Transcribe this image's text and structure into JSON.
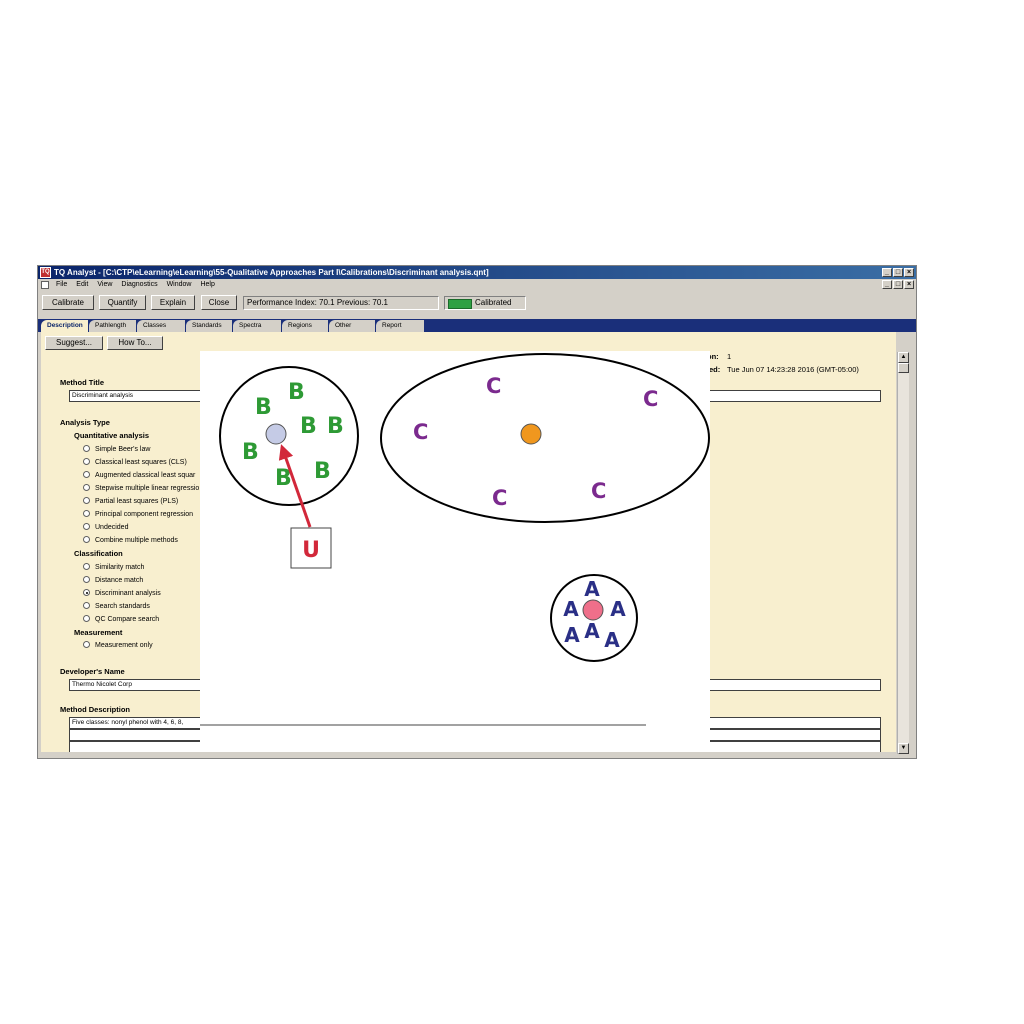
{
  "window": {
    "title": "TQ Analyst  - [C:\\CTP\\eLearning\\eLearning\\55-Qualitative Approaches Part I\\Calibrations\\Discriminant analysis.qnt]",
    "app_icon_label": "TQ"
  },
  "menu": [
    "File",
    "Edit",
    "View",
    "Diagnostics",
    "Window",
    "Help"
  ],
  "toolbar": {
    "buttons": [
      "Calibrate",
      "Quantify",
      "Explain",
      "Close"
    ],
    "performance": "Performance Index:  70.1  Previous:  70.1",
    "status": "Calibrated",
    "status_color": "#2ea043"
  },
  "tabs": [
    "Description",
    "Pathlength",
    "Classes",
    "Standards",
    "Spectra",
    "Regions",
    "Other",
    "Report"
  ],
  "description": {
    "suggest_label": "Suggest...",
    "howto_label": "How To...",
    "version_label": "on:",
    "version_value": "1",
    "date_label": "ed:",
    "date_value": "Tue Jun 07 14:23:28 2016 (GMT-05:00)",
    "method_title_label": "Method Title",
    "method_title_value": "Discriminant analysis",
    "analysis_type_label": "Analysis Type",
    "quantitative_label": "Quantitative analysis",
    "quantitative_options": [
      "Simple Beer's law",
      "Classical least squares (CLS)",
      "Augmented classical least squar",
      "Stepwise multiple linear regressio",
      "Partial least squares (PLS)",
      "Principal component regression",
      "Undecided",
      "Combine multiple methods"
    ],
    "classification_label": "Classification",
    "classification_options": [
      "Similarity match",
      "Distance match",
      "Discriminant analysis",
      "Search standards",
      "QC Compare search"
    ],
    "selected_option": "Discriminant analysis",
    "measurement_label": "Measurement",
    "measurement_options": [
      "Measurement only"
    ],
    "developer_label": "Developer's Name",
    "developer_value": "Thermo Nicolet Corp",
    "method_desc_label": "Method Description",
    "method_desc_value": "Five classes: nonyl phenol with 4, 6, 8,"
  },
  "diagram": {
    "class_b_letters": [
      "B",
      "B",
      "B",
      "B",
      "B",
      "B",
      "B"
    ],
    "class_c_letters": [
      "C",
      "C",
      "C",
      "C",
      "C"
    ],
    "class_a_letters": [
      "A",
      "A",
      "A",
      "A",
      "A",
      "A"
    ],
    "unknown_label": "U",
    "colors": {
      "class_b": "#2e9a35",
      "class_c": "#7b2a8e",
      "class_a": "#2a2f86",
      "centroid_b": "#c5cbe6",
      "centroid_c": "#f0971e",
      "centroid_a": "#ef6f8a",
      "arrow": "#d2283a",
      "unknown": "#d2283a"
    }
  }
}
